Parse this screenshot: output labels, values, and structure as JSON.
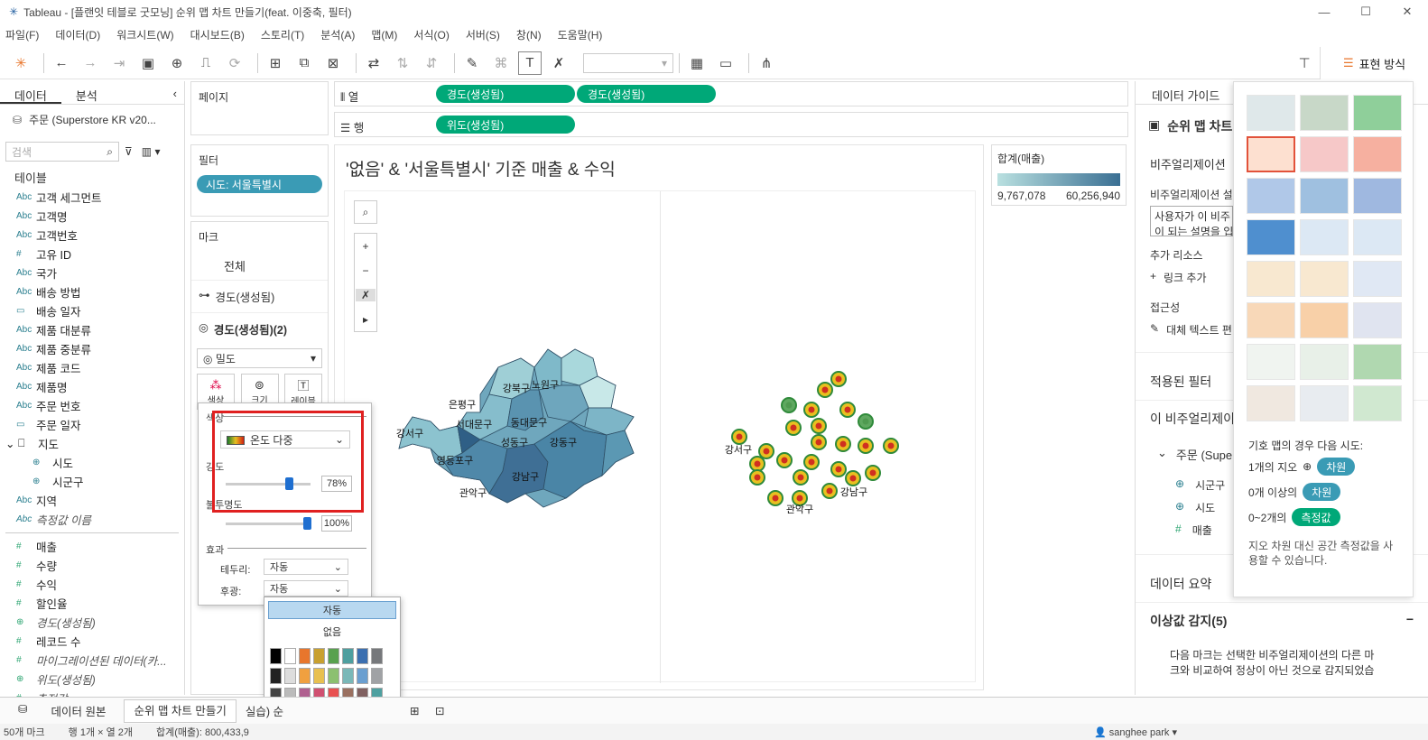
{
  "window": {
    "title": "Tableau - [플랜잇 테블로 굿모닝] 순위 맵 차트 만들기(feat. 이중축, 필터)",
    "min": "—",
    "max": "☐",
    "close": "✕"
  },
  "menu": [
    "파일(F)",
    "데이터(D)",
    "워크시트(W)",
    "대시보드(B)",
    "스토리(T)",
    "분석(A)",
    "맵(M)",
    "서식(O)",
    "서버(S)",
    "창(N)",
    "도움말(H)"
  ],
  "showme_button": "표현 방식",
  "left": {
    "tab_data": "데이터",
    "tab_analysis": "분석",
    "datasource": "주문 (Superstore KR v20...",
    "search_placeholder": "검색",
    "tables_header": "테이블",
    "fields": [
      {
        "type": "Abc",
        "name": "고객 세그먼트"
      },
      {
        "type": "Abc",
        "name": "고객명"
      },
      {
        "type": "Abc",
        "name": "고객번호"
      },
      {
        "type": "#",
        "name": "고유 ID"
      },
      {
        "type": "Abc",
        "name": "국가"
      },
      {
        "type": "Abc",
        "name": "배송 방법"
      },
      {
        "type": "cal",
        "name": "배송 일자"
      },
      {
        "type": "Abc",
        "name": "제품 대분류"
      },
      {
        "type": "Abc",
        "name": "제품 중분류"
      },
      {
        "type": "Abc",
        "name": "제품 코드"
      },
      {
        "type": "Abc",
        "name": "제품명"
      },
      {
        "type": "Abc",
        "name": "주문 번호"
      },
      {
        "type": "cal",
        "name": "주문 일자"
      }
    ],
    "geo_header": "지도",
    "geo_items": [
      "시도",
      "시군구"
    ],
    "fields2": [
      {
        "type": "Abc",
        "name": "지역"
      },
      {
        "type": "Abc",
        "name": "측정값 이름",
        "it": true
      }
    ],
    "measures": [
      {
        "type": "#",
        "name": "매출"
      },
      {
        "type": "#",
        "name": "수량"
      },
      {
        "type": "#",
        "name": "수익"
      },
      {
        "type": "#",
        "name": "할인율"
      },
      {
        "type": "geo",
        "name": "경도(생성됨)",
        "it": true
      },
      {
        "type": "#",
        "name": "레코드 수"
      },
      {
        "type": "#",
        "name": "마이그레이션된 데이터(카...",
        "it": true
      },
      {
        "type": "geo",
        "name": "위도(생성됨)",
        "it": true
      },
      {
        "type": "#",
        "name": "측정값",
        "it": true
      }
    ]
  },
  "pages": {
    "label": "페이지"
  },
  "filters": {
    "label": "필터",
    "pill": "시도: 서울특별시"
  },
  "marks": {
    "label": "마크",
    "all": "전체",
    "layer1": "경도(생성됨)",
    "layer2": "경도(생성됨)(2)",
    "type": "밀도",
    "btn_color": "색상",
    "btn_size": "크기",
    "btn_label": "레이블"
  },
  "columns": {
    "label": "열",
    "pills": [
      "경도(생성됨)",
      "경도(생성됨)"
    ]
  },
  "rows": {
    "label": "행",
    "pills": [
      "위도(생성됨)"
    ]
  },
  "viz": {
    "title": "'없음' & '서울특별시' 기준 매출 & 수익",
    "map_labels_left": [
      "강북구",
      "노원구",
      "은평구",
      "서대문구",
      "동대문구",
      "성동구",
      "강동구",
      "강서구",
      "영등포구",
      "강남구",
      "관악구"
    ],
    "map_labels_right": [
      "강서구",
      "강남구",
      "관악구"
    ]
  },
  "legend": {
    "title": "합계(매출)",
    "min": "9,767,078",
    "max": "60,256,940"
  },
  "popup": {
    "color_label": "색상",
    "palette": "온도 다중",
    "intensity_label": "강도",
    "intensity_value": "78%",
    "opacity_label": "불투명도",
    "opacity_value": "100%",
    "effects_label": "효과",
    "border_label": "테두리:",
    "border_value": "자동",
    "halo_label": "후광:",
    "halo_value": "자동"
  },
  "palette_popup": {
    "auto": "자동",
    "none": "없음"
  },
  "right": {
    "title": "데이터 가이드",
    "chart_name": "순위 맵 차트",
    "viz_desc": "비주얼리제이션",
    "viz_desc_sub": "비주얼리제이션 설",
    "desc_box": "사용자가 이 비주\n이 되는 설명을 입",
    "add_resources": "추가 리소스",
    "add_link": "링크 추가",
    "accessibility": "접근성",
    "alt_text": "대체 텍스트 편",
    "applied_filters": "적용된 필터",
    "viz_fields": "이 비주얼리제이",
    "source": "주문 (Supe",
    "f1": "시군구",
    "f2": "시도",
    "f3": "매출",
    "data_summary": "데이터 요약",
    "outliers": "이상값 감지(5)",
    "outlier_desc": "다음 마크는 선택한 비주얼리제이션의 다른 마크와 비교하여 정상이 아닌 것으로 감지되었습"
  },
  "showme": {
    "hint_title": "기호 맵의 경우 다음 시도:",
    "r1": "1개의 지오",
    "r1b": "차원",
    "r2": "0개 이상의",
    "r2b": "차원",
    "r3": "0~2개의",
    "r3b": "측정값",
    "note": "지오 차원 대신 공간 측정값을 사용할 수 있습니다."
  },
  "bottom": {
    "datasource_tab": "데이터 원본",
    "sheet_tab": "순위 맵 차트 만들기",
    "sheet2": "실습) 순"
  },
  "status": {
    "marks": "50개 마크",
    "rows": "행 1개 × 열 2개",
    "sum": "합계(매출): 800,433,9",
    "user": "sanghee park"
  },
  "colors": {
    "green": "#00a878",
    "blue": "#3a9bb5",
    "red": "#e02020"
  }
}
